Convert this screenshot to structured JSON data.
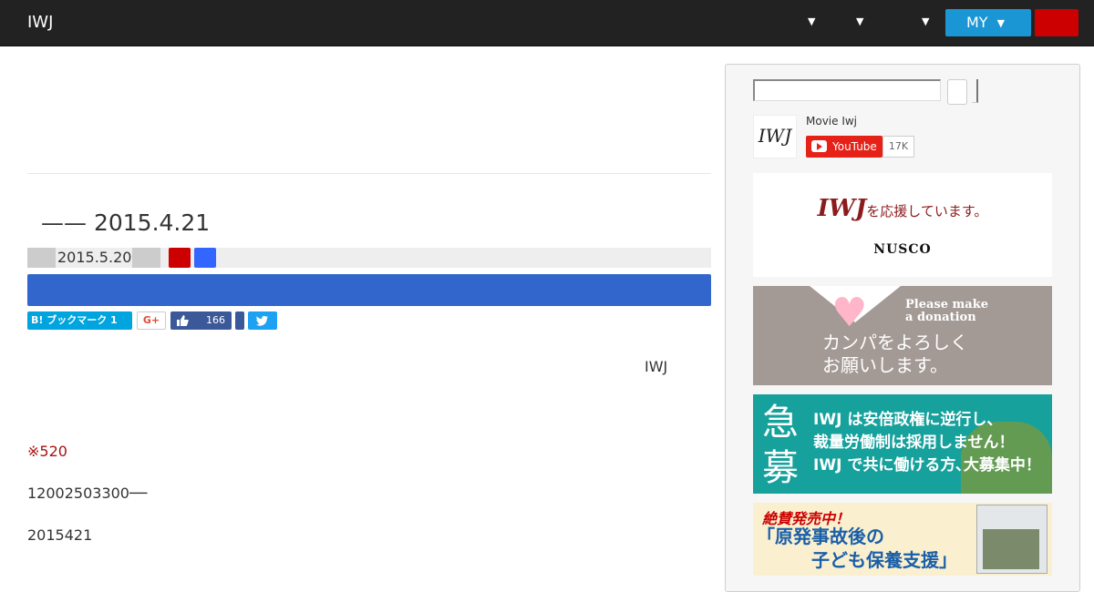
{
  "header": {
    "logo": "IWJ",
    "nav_carets": [
      "▼",
      "▼",
      "▼"
    ],
    "my_button": {
      "label": "MY",
      "caret": "▼"
    }
  },
  "article": {
    "title": "—— 2015.4.21",
    "meta_date": "2015.5.20",
    "share": {
      "hatena_label": "B! ブックマーク 1",
      "gplus_label": "G+",
      "fb_count": "166"
    },
    "body": {
      "iwj": "IWJ",
      "note": "※520",
      "line1": "12002503300──",
      "line2": "2015421"
    }
  },
  "sidebar": {
    "youtube": {
      "logo_text": "IWJ",
      "channel_name": "Movie Iwj",
      "button_label": "YouTube",
      "subscriber_count": "17K"
    },
    "ad_nusco": {
      "tag_logo": "IWJ",
      "tag_text": "を応援しています。",
      "brand": "NUSCO"
    },
    "ad_donation": {
      "english_line1": "Please make",
      "english_line2": "a donation",
      "jp_line1": "カンパをよろしく",
      "jp_line2": "お願いします。"
    },
    "ad_recruit": {
      "big_chars": "急募",
      "line1": "IWJ は安倍政権に逆行し、",
      "line2": "裁量労働制は採用しません！",
      "line3": "IWJ で共に働ける方､大募集中！"
    },
    "ad_book": {
      "line1": "絶賛発売中！",
      "line2": "「原発事故後の",
      "line3": "子ども保養支援」"
    }
  }
}
